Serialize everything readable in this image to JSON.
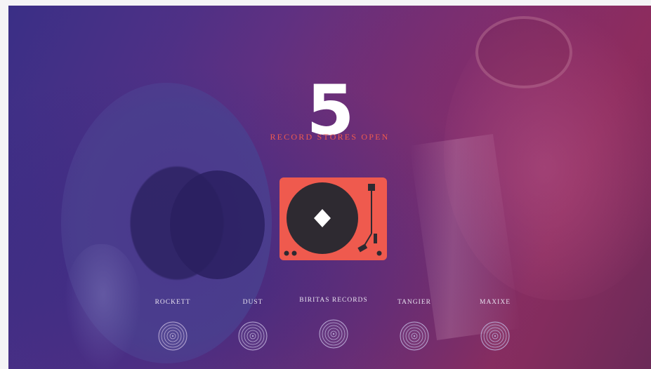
{
  "hero": {
    "count": "5",
    "label": "RECORD STORES OPEN"
  },
  "turntable": {
    "icon": "turntable-icon",
    "colors": {
      "body": "#ef5a4e",
      "record": "#2e2a31",
      "center": "#ffffff"
    }
  },
  "stores": [
    {
      "name": "ROCKETT",
      "icon": "vinyl-record-icon"
    },
    {
      "name": "DUST",
      "icon": "vinyl-record-icon"
    },
    {
      "name": "BIRITAS RECORDS",
      "icon": "vinyl-record-icon"
    },
    {
      "name": "TANGIER",
      "icon": "vinyl-record-icon"
    },
    {
      "name": "MAXIXE",
      "icon": "vinyl-record-icon"
    }
  ],
  "theme": {
    "accent": "#ef5a4e",
    "text": "#ffffff"
  }
}
